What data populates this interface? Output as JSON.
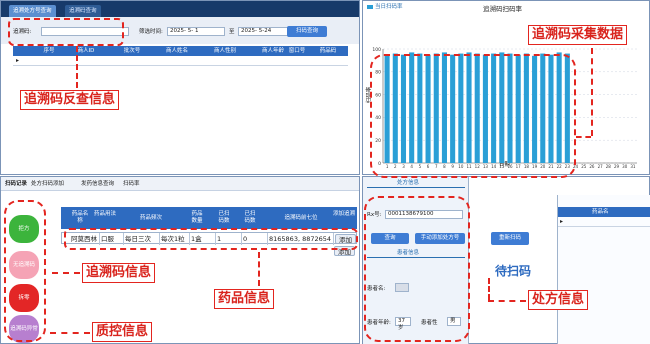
{
  "panel_query": {
    "tabs": [
      "追溯处方号查询",
      "追溯码查询"
    ],
    "trace_label": "追溯码:",
    "filter_label": "筛选时间:",
    "date_from": "2025- 5- 1",
    "date_sep": "至",
    "date_to": "2025- 5-24",
    "scan_btn": "扫码查询",
    "columns": [
      "序号",
      "商人ID",
      "批次号",
      "商人姓名",
      "商人性别",
      "商人年龄",
      "窗口号",
      "药品码"
    ],
    "row_marker": "▸"
  },
  "panel_chart": {
    "header": "当日扫码率",
    "title": "追溯码扫码率",
    "ylabel": "扫码率",
    "xlabel": "日期"
  },
  "chart_data": {
    "type": "bar",
    "title": "追溯码扫码率",
    "xlabel": "日期",
    "ylabel": "扫码率",
    "ylim": [
      0,
      100
    ],
    "yticks": [
      0,
      20,
      40,
      60,
      80,
      100
    ],
    "categories": [
      "1",
      "2",
      "3",
      "4",
      "5",
      "6",
      "7",
      "8",
      "9",
      "10",
      "11",
      "12",
      "13",
      "14",
      "15",
      "16",
      "17",
      "18",
      "19",
      "20",
      "21",
      "22",
      "23",
      "24",
      "25",
      "26",
      "27",
      "28",
      "29",
      "30",
      "31"
    ],
    "values": [
      94,
      96,
      95,
      97,
      96,
      95,
      96,
      97,
      95,
      96,
      97,
      96,
      95,
      96,
      97,
      96,
      95,
      96,
      94,
      96,
      95,
      97,
      96,
      null,
      null,
      null,
      null,
      null,
      null,
      null,
      null
    ],
    "colors": {
      "bar": "#2a9fd6"
    }
  },
  "panel_drug": {
    "tabs": [
      "扫码记录",
      "处方扫码添加",
      "发药信息查询",
      "扫码率"
    ],
    "columns": [
      "药品名称",
      "药品用法",
      "药品频次",
      "药品数量",
      "已扫码数",
      "已扫码数",
      "追溯码前七位",
      "添加追溯"
    ],
    "row": [
      "阿莫西林",
      "口服",
      "每日三次",
      "每次1粒",
      "1盒",
      "1",
      "0",
      "8165863, 8872654",
      "添加"
    ],
    "row2_add": "添加",
    "side_buttons": [
      {
        "label": "拒方",
        "color": "#3cb43c"
      },
      {
        "label": "无追溯码",
        "color": "#f5a3b5"
      },
      {
        "label": "拆零",
        "color": "#e32626"
      },
      {
        "label": "追溯码异常",
        "color": "#b77fcf"
      }
    ]
  },
  "panel_rx": {
    "section1": "处方信息",
    "rx_label": "Rx号:",
    "rx_value": "0001138679100",
    "btn_query": "查询",
    "btn_manual": "手动添加处方号",
    "section2": "患者信息",
    "name_label": "患者名:",
    "age_label": "患者年龄:",
    "age_value": "37岁",
    "sex_label": "患者性",
    "sex_value": "男",
    "rescan_btn": "重新扫码",
    "waiting": "待扫码",
    "drug_col": "药品名",
    "row_marker": "▸"
  },
  "annotations": {
    "trace_reverse": "追溯码反查信息",
    "trace_collect": "追溯码采集数据",
    "trace_info": "追溯码信息",
    "drug_info": "药品信息",
    "qc_info": "质控信息",
    "rx_info": "处方信息"
  }
}
